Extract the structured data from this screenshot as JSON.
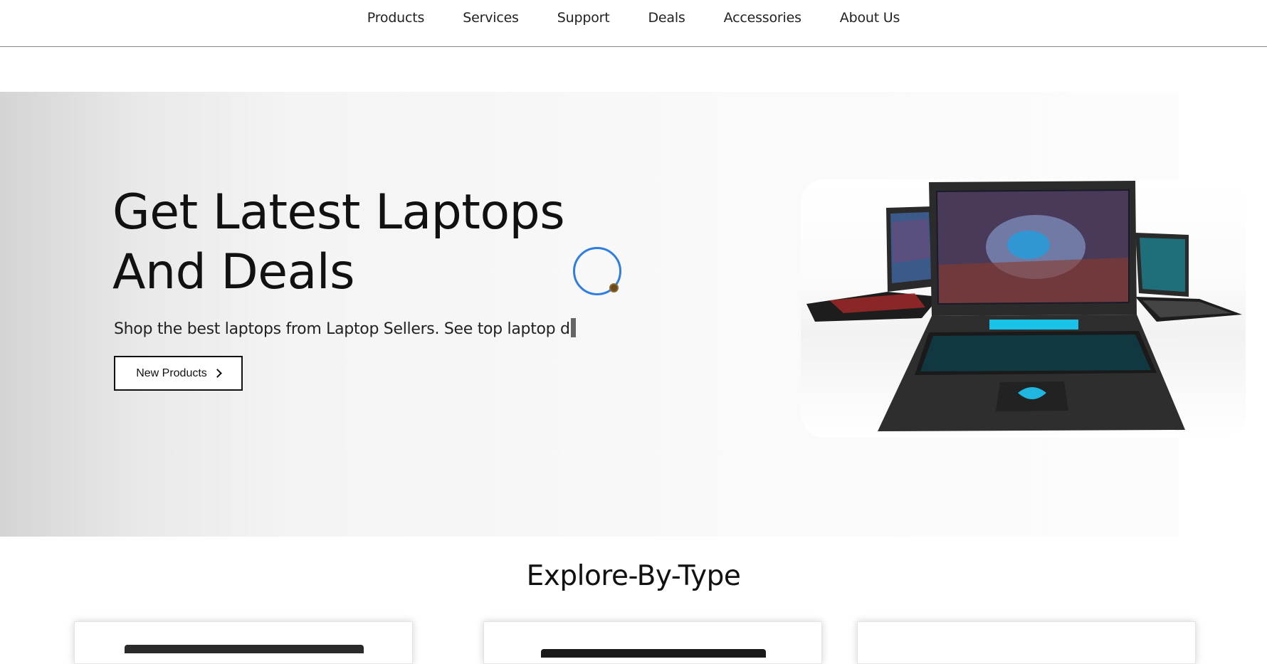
{
  "nav": {
    "items": [
      "Products",
      "Services",
      "Support",
      "Deals",
      "Accessories",
      "About Us"
    ]
  },
  "hero": {
    "title_line1": "Get Latest Laptops",
    "title_line2": "And Deals",
    "subtitle": "Shop the best laptops from Laptop Sellers. See top laptop d",
    "button_label": "New Products"
  },
  "explore": {
    "title": "Explore-By-Type"
  },
  "colors": {
    "spinner": "#2f7de1",
    "text": "#111111"
  }
}
